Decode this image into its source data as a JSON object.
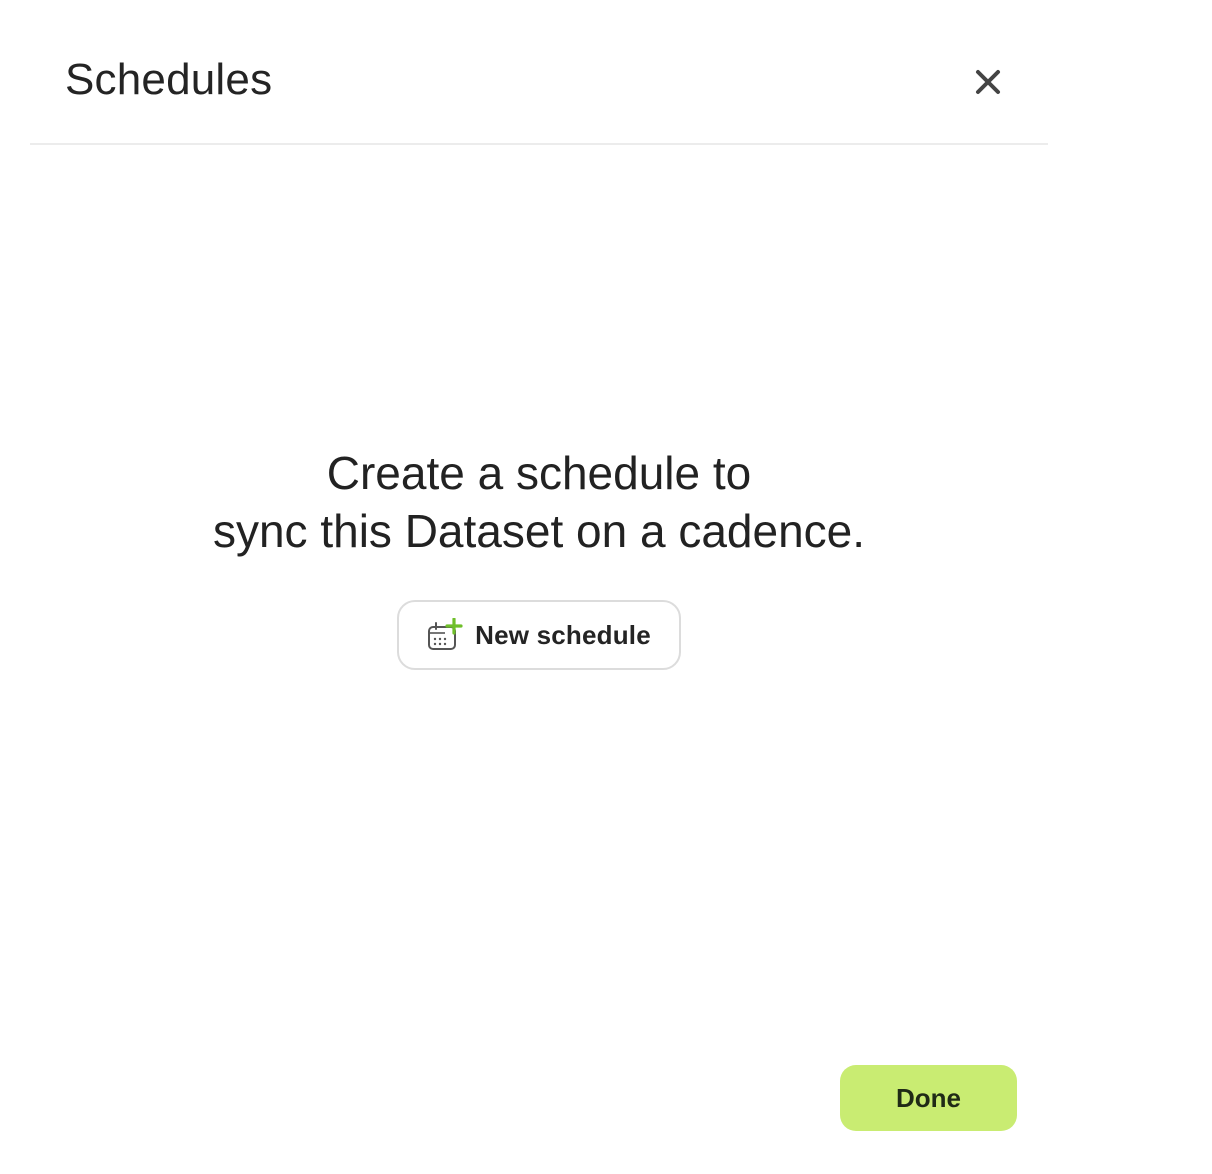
{
  "dialog": {
    "title": "Schedules",
    "close_icon": "close-icon"
  },
  "empty_state": {
    "line1": "Create a schedule to",
    "line2": "sync this Dataset on a cadence.",
    "new_schedule_label": "New schedule",
    "new_schedule_icon": "calendar-add-icon"
  },
  "footer": {
    "done_label": "Done"
  },
  "colors": {
    "accent": "#c9ec72",
    "icon_plus": "#6fbf2a",
    "border": "#dcdcdc",
    "divider": "#ececec"
  }
}
